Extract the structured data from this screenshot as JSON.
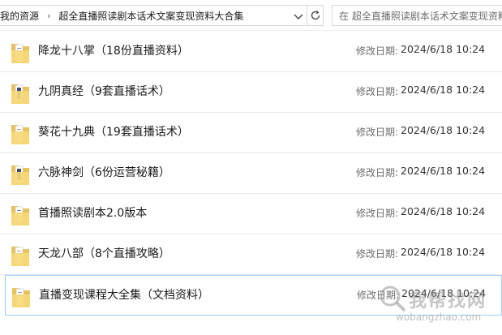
{
  "address": {
    "crumbs": [
      "我的资源",
      "超全直播照读剧本话术文案变现资料大合集"
    ],
    "search_placeholder": "在 超全直播照读剧本话术文案变现资料大合集 中搜索"
  },
  "files": [
    {
      "name": "降龙十八掌（18份直播资料）",
      "date_label": "修改日期:",
      "date": "2024/6/18 10:24"
    },
    {
      "name": "九阴真经（9套直播话术）",
      "date_label": "修改日期:",
      "date": "2024/6/18 10:24"
    },
    {
      "name": "葵花十九典（19套直播话术）",
      "date_label": "修改日期:",
      "date": "2024/6/18 10:24"
    },
    {
      "name": "六脉神剑（6份运营秘籍）",
      "date_label": "修改日期:",
      "date": "2024/6/18 10:24"
    },
    {
      "name": "首播照读剧本2.0版本",
      "date_label": "修改日期:",
      "date": "2024/6/18 10:24"
    },
    {
      "name": "天龙八部（8个直播攻略）",
      "date_label": "修改日期:",
      "date": "2024/6/18 10:24"
    },
    {
      "name": "直播变现课程大全集（文档资料）",
      "date_label": "修改日期:",
      "date": "2024/6/18 10:24"
    }
  ],
  "watermark": {
    "text": "我帮找网",
    "url": "wobangzhao.com"
  },
  "colors": {
    "selection_border": "#99d1ff",
    "folder": "#e8c25c",
    "folder_light": "#f6d97a"
  }
}
